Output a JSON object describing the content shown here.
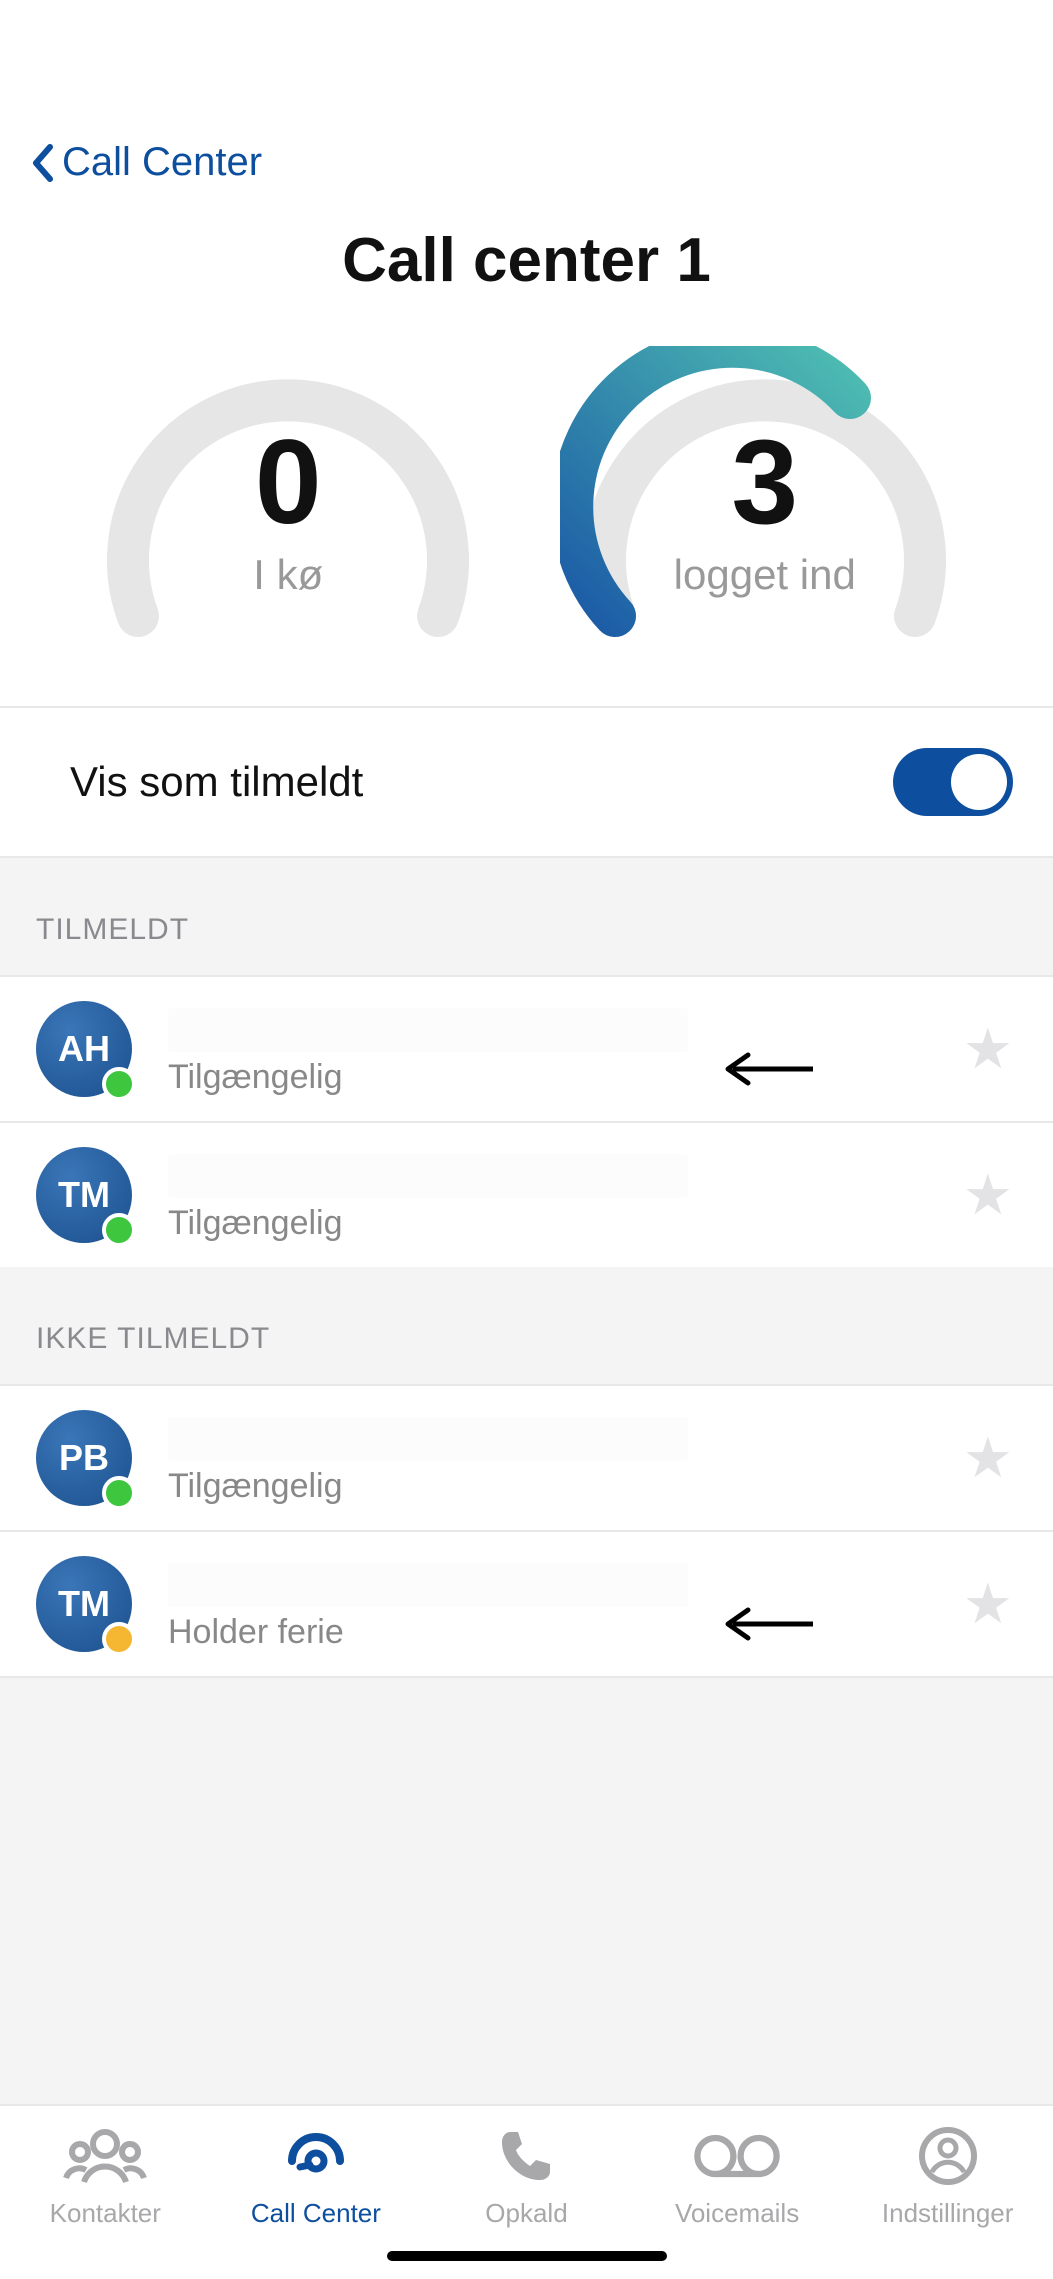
{
  "nav": {
    "back_label": "Call Center"
  },
  "page_title": "Call center 1",
  "gauges": {
    "queue": {
      "value": "0",
      "label": "I kø",
      "fill_ratio": 0
    },
    "logged_in": {
      "value": "3",
      "label": "logget ind",
      "fill_ratio": 0.5
    }
  },
  "toggle": {
    "label": "Vis som tilmeldt",
    "on": true
  },
  "sections": {
    "enrolled_header": "TILMELDT",
    "not_enrolled_header": "IKKE TILMELDT"
  },
  "users": {
    "enrolled": [
      {
        "initials": "AH",
        "status": "Tilgængelig",
        "presence": "green",
        "annotated": true
      },
      {
        "initials": "TM",
        "status": "Tilgængelig",
        "presence": "green",
        "annotated": false
      }
    ],
    "not_enrolled": [
      {
        "initials": "PB",
        "status": "Tilgængelig",
        "presence": "green",
        "annotated": false
      },
      {
        "initials": "TM",
        "status": "Holder ferie",
        "presence": "orange",
        "annotated": true
      }
    ]
  },
  "tabbar": {
    "items": [
      {
        "label": "Kontakter",
        "icon": "contacts-icon",
        "active": false
      },
      {
        "label": "Call Center",
        "icon": "call-center-icon",
        "active": true
      },
      {
        "label": "Opkald",
        "icon": "phone-icon",
        "active": false
      },
      {
        "label": "Voicemails",
        "icon": "voicemail-icon",
        "active": false
      },
      {
        "label": "Indstillinger",
        "icon": "settings-icon",
        "active": false
      }
    ]
  },
  "colors": {
    "accent": "#0d4f9e",
    "gauge_gradient_start": "#1b5aa6",
    "gauge_gradient_end": "#4fbfb2"
  }
}
